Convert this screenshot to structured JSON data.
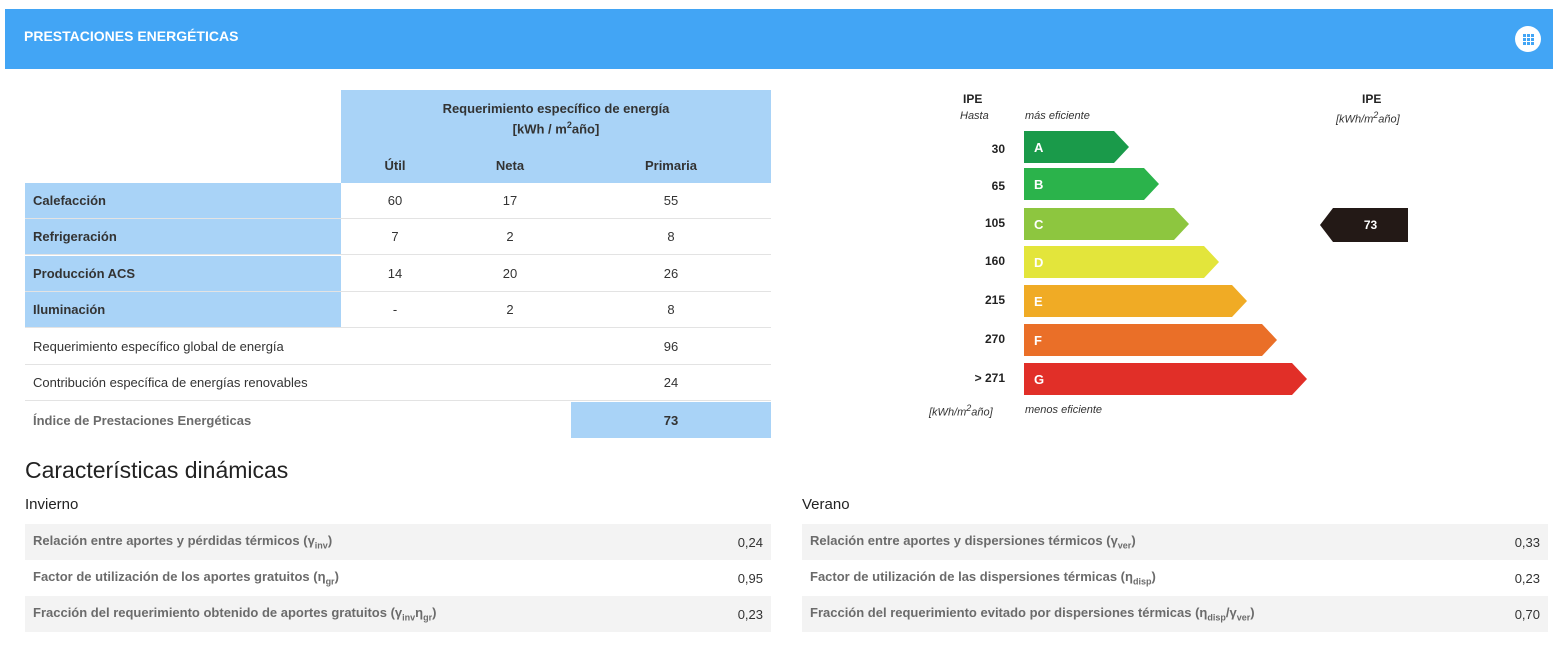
{
  "header": {
    "title": "PRESTACIONES ENERGÉTICAS",
    "menu_icon": "grid-menu-icon"
  },
  "energy_table": {
    "group_header": "Requerimiento específico de energía",
    "unit_prefix": "[kWh / m",
    "unit_sup": "2",
    "unit_suffix": "año]",
    "columns": [
      "Útil",
      "Neta",
      "Primaria"
    ],
    "rows": [
      {
        "label": "Calefacción",
        "util": "60",
        "neta": "17",
        "primaria": "55"
      },
      {
        "label": "Refrigeración",
        "util": "7",
        "neta": "2",
        "primaria": "8"
      },
      {
        "label": "Producción ACS",
        "util": "14",
        "neta": "20",
        "primaria": "26"
      },
      {
        "label": "Iluminación",
        "util": "-",
        "neta": "2",
        "primaria": "8"
      }
    ],
    "global_label": "Requerimiento específico global de energía",
    "global_value": "96",
    "renewables_label": "Contribución específica de energías renovables",
    "renewables_value": "24",
    "index_label": "Índice de Prestaciones Energéticas",
    "index_value": "73"
  },
  "energy_label": {
    "left_head": "IPE",
    "left_sub": "Hasta",
    "top_note": "más eficiente",
    "bottom_note": "menos eficiente",
    "bottom_unit_prefix": "[kWh/m",
    "bottom_unit_sup": "2",
    "bottom_unit_suffix": "año]",
    "right_head": "IPE",
    "right_unit_prefix": "[kWh/m",
    "right_unit_sup": "2",
    "right_unit_suffix": "año]",
    "classes": [
      {
        "letter": "A",
        "limit": "30",
        "color": "#1a9a4a"
      },
      {
        "letter": "B",
        "limit": "65",
        "color": "#2bb34b"
      },
      {
        "letter": "C",
        "limit": "105",
        "color": "#8dc63f"
      },
      {
        "letter": "D",
        "limit": "160",
        "color": "#e3e53b"
      },
      {
        "letter": "E",
        "limit": "215",
        "color": "#f0ab25"
      },
      {
        "letter": "F",
        "limit": "270",
        "color": "#ea6f28"
      },
      {
        "letter": "G",
        "limit": "> 271",
        "color": "#e12f28"
      }
    ],
    "current_value": "73",
    "current_class": "C"
  },
  "dynamic": {
    "title": "Características dinámicas",
    "winter": {
      "title": "Invierno",
      "rows": [
        {
          "label": "Relación entre aportes y pérdidas térmicos",
          "sym": "γ",
          "sub": "inv",
          "value": "0,24"
        },
        {
          "label": "Factor de utilización de los aportes gratuitos",
          "sym": "η",
          "sub": "gr",
          "value": "0,95"
        },
        {
          "label": "Fracción del requerimiento obtenido de aportes gratuitos",
          "sym": "γ",
          "sub": "inv",
          "sym2": "η",
          "sub2": "gr",
          "value": "0,23"
        }
      ]
    },
    "summer": {
      "title": "Verano",
      "rows": [
        {
          "label": "Relación entre aportes y dispersiones térmicos",
          "sym": "γ",
          "sub": "ver",
          "value": "0,33"
        },
        {
          "label": "Factor de utilización de las dispersiones térmicas",
          "sym": "η",
          "sub": "disp",
          "value": "0,23"
        },
        {
          "label": "Fracción del requerimiento evitado por dispersiones térmicas",
          "sym": "η",
          "sub": "disp",
          "sym2": "/γ",
          "sub2": "ver",
          "value": "0,70"
        }
      ]
    }
  }
}
